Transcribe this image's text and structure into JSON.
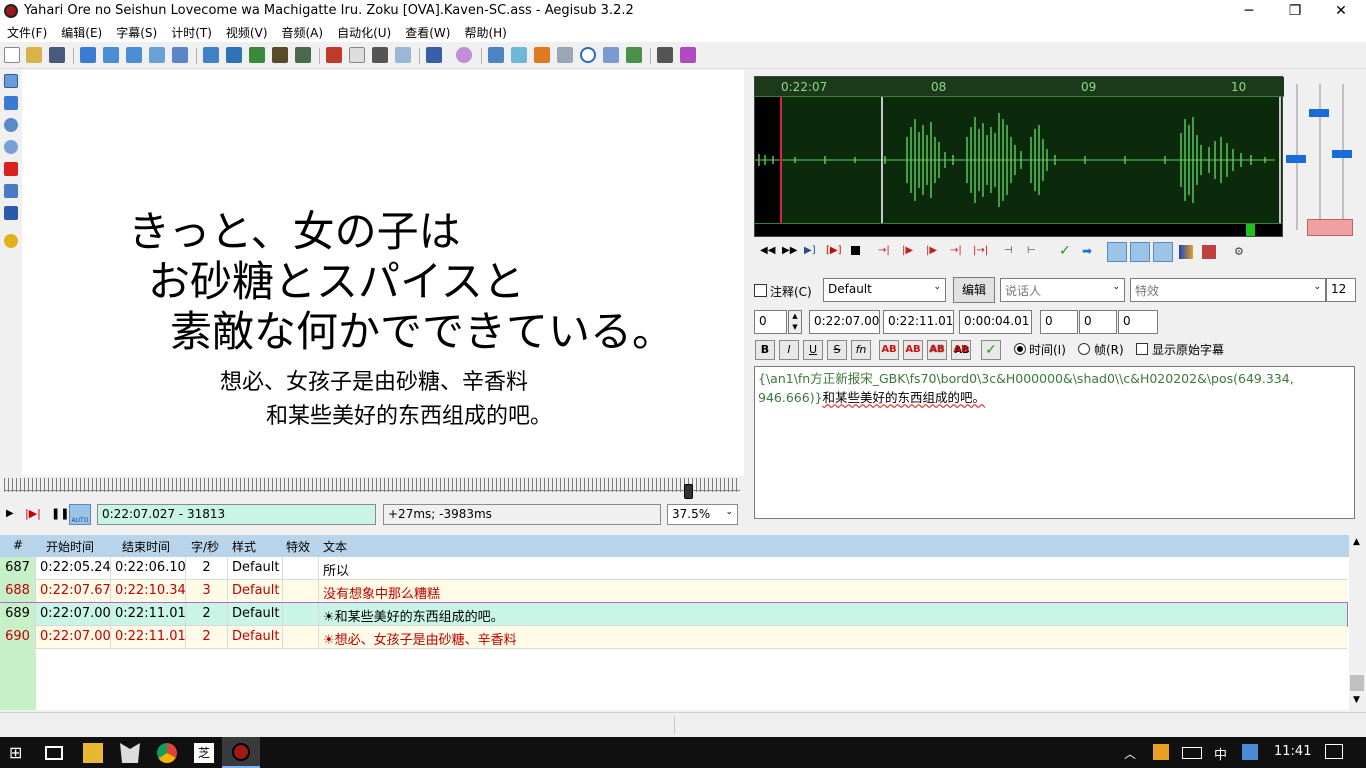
{
  "window": {
    "title": "Yahari Ore no Seishun Lovecome wa Machigatte Iru. Zoku [OVA].Kaven-SC.ass - Aegisub 3.2.2"
  },
  "window_controls": {
    "minimize": "─",
    "maximize": "❐",
    "close": "✕"
  },
  "menu": [
    "文件(F)",
    "编辑(E)",
    "字幕(S)",
    "计时(T)",
    "视频(V)",
    "音频(A)",
    "自动化(U)",
    "查看(W)",
    "帮助(H)"
  ],
  "video": {
    "jp_line1": "きっと、女の子は",
    "jp_line2": "お砂糖とスパイスと",
    "jp_line3": "素敵な何かでできている。",
    "cn_line1": "想必、女孩子是由砂糖、辛香料",
    "cn_line2": "和某些美好的东西组成的吧。"
  },
  "video_controls": {
    "timecode": "0:22:07.027 - 31813",
    "offset": "+27ms; -3983ms",
    "zoom": "37.5%",
    "auto_label": "AUTO"
  },
  "waveform": {
    "time_label": "0:22:07",
    "tick_08": "08",
    "tick_09": "09",
    "tick_10": "10"
  },
  "edit": {
    "comment_label": "注释(C)",
    "style": "Default",
    "edit_button": "编辑",
    "actor_placeholder": "说话人",
    "effect_placeholder": "特效",
    "char_count": "12",
    "layer": "0",
    "start_time": "0:22:07.00",
    "end_time": "0:22:11.01",
    "duration": "0:00:04.01",
    "margin_l": "0",
    "margin_r": "0",
    "margin_v": "0",
    "bold": "B",
    "italic": "I",
    "underline": "U",
    "strike": "S",
    "fn": "fn",
    "color_labels": [
      "AB",
      "AB",
      "AB",
      "AB"
    ],
    "time_radio": "时间(I)",
    "frame_radio": "帧(R)",
    "show_original": "显示原始字幕",
    "text_tags_1": "{\\an1\\fn方正新报宋_GBK\\fs70\\bord0\\3c&H000000&\\shad0\\\\c&H020202&\\pos(649.334,",
    "text_tags_2": "946.666)}",
    "text_body": "和某些美好的东西组成的吧。"
  },
  "grid": {
    "headers": [
      "#",
      "开始时间",
      "结束时间",
      "字/秒",
      "样式",
      "特效",
      "文本"
    ],
    "rows": [
      {
        "num": "687",
        "start": "0:22:05.24",
        "end": "0:22:06.10",
        "cps": "2",
        "style": "Default",
        "effect": "",
        "text": "所以"
      },
      {
        "num": "688",
        "start": "0:22:07.67",
        "end": "0:22:10.34",
        "cps": "3",
        "style": "Default",
        "effect": "",
        "text": "没有想象中那么糟糕"
      },
      {
        "num": "689",
        "start": "0:22:07.00",
        "end": "0:22:11.01",
        "cps": "2",
        "style": "Default",
        "effect": "",
        "text": "☀和某些美好的东西组成的吧。"
      },
      {
        "num": "690",
        "start": "0:22:07.00",
        "end": "0:22:11.01",
        "cps": "2",
        "style": "Default",
        "effect": "",
        "text": "☀想必、女孩子是由砂糖、辛香料"
      }
    ]
  },
  "taskbar": {
    "ime": "中",
    "clock": "11:41"
  },
  "colors": {
    "waveform_bg": "#0b2a0b",
    "waveform_wave": "#5fcf5f",
    "selected_row": "#c8f5e6",
    "conflict_row": "#fffbe6",
    "conflict_text": "#c00000",
    "header_bg": "#b8d4ea"
  }
}
